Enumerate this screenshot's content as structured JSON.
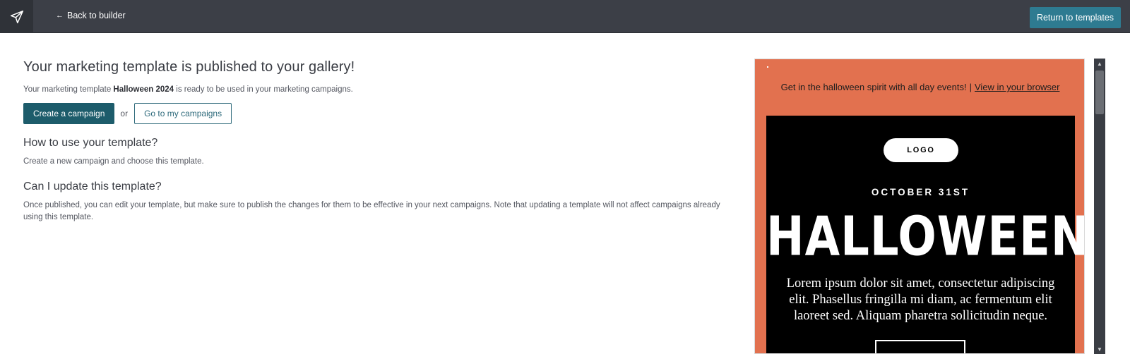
{
  "topbar": {
    "logo_icon": "paper-plane-icon",
    "back_arrow": "←",
    "back_label": "Back to builder",
    "return_label": "Return to templates",
    "return_color": "#2e7b91"
  },
  "main": {
    "title": "Your marketing template is published to your gallery!",
    "subtitle_prefix": "Your marketing template ",
    "template_name": "Halloween 2024",
    "subtitle_suffix": " is ready to be used in your marketing campaigns.",
    "create_campaign_label": "Create a campaign",
    "or_label": "or",
    "go_campaigns_label": "Go to my campaigns",
    "how_heading": "How to use your template?",
    "how_text": "Create a new campaign and choose this template.",
    "update_heading": "Can I update this template?",
    "update_text": "Once published, you can edit your template, but make sure to publish the changes for them to be effective in your next campaigns. Note that updating a template will not affect campaigns already using this template."
  },
  "preview": {
    "preheader_text": "Get in the halloween spirit with all day events!",
    "preheader_separator": "|",
    "view_in_browser": "View in your browser",
    "logo_label": "LOGO",
    "date_label": "OCTOBER 31ST",
    "headline": "HALLOWEEN",
    "body_text": "Lorem ipsum dolor sit amet, consectetur adipiscing elit. Phasellus fringilla mi diam, ac fermentum elit laoreet sed. Aliquam pharetra sollicitudin neque.",
    "background_color": "#e2714f"
  },
  "scrollbar": {
    "up_glyph": "▲",
    "down_glyph": "▼"
  }
}
